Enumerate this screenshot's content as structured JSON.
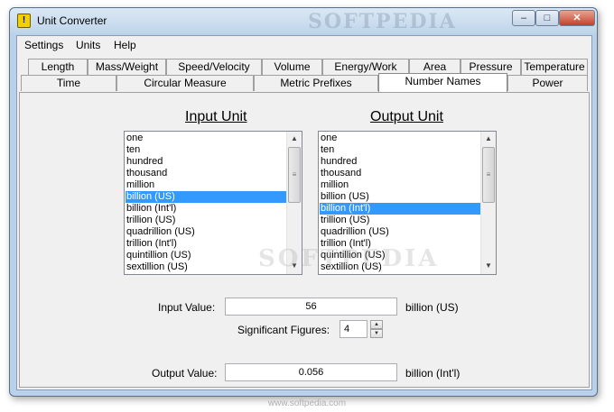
{
  "window": {
    "title": "Unit Converter",
    "watermark": "SOFTPEDIA"
  },
  "menu": [
    "Settings",
    "Units",
    "Help"
  ],
  "tabs_top": [
    "Length",
    "Mass/Weight",
    "Speed/Velocity",
    "Volume",
    "Energy/Work",
    "Area",
    "Pressure",
    "Temperature"
  ],
  "tabs_bottom": [
    "Time",
    "Circular Measure",
    "Metric Prefixes",
    "Number Names",
    "Power"
  ],
  "active_tab": "Number Names",
  "input_unit": {
    "heading": "Input Unit",
    "items": [
      "one",
      "ten",
      "hundred",
      "thousand",
      "million",
      "billion (US)",
      "billion (Int'l)",
      "trillion (US)",
      "quadrillion (US)",
      "trillion (Int'l)",
      "quintillion (US)",
      "sextillion (US)"
    ],
    "selected": "billion (US)"
  },
  "output_unit": {
    "heading": "Output Unit",
    "items": [
      "one",
      "ten",
      "hundred",
      "thousand",
      "million",
      "billion (US)",
      "billion (Int'l)",
      "trillion (US)",
      "quadrillion (US)",
      "trillion (Int'l)",
      "quintillion (US)",
      "sextillion (US)"
    ],
    "selected": "billion (Int'l)"
  },
  "form": {
    "input_label": "Input Value:",
    "input_value": "56",
    "input_unit_label": "billion (US)",
    "sigfig_label": "Significant Figures:",
    "sigfig_value": "4",
    "output_label": "Output Value:",
    "output_value": "0.056",
    "output_unit_label": "billion (Int'l)"
  },
  "footer": {
    "url": "www.softpedia.com",
    "watermark": "SOFTPEDIA"
  },
  "colors": {
    "selection": "#3399ff",
    "frame": "#b9d1ea",
    "face": "#f0f0f0"
  }
}
